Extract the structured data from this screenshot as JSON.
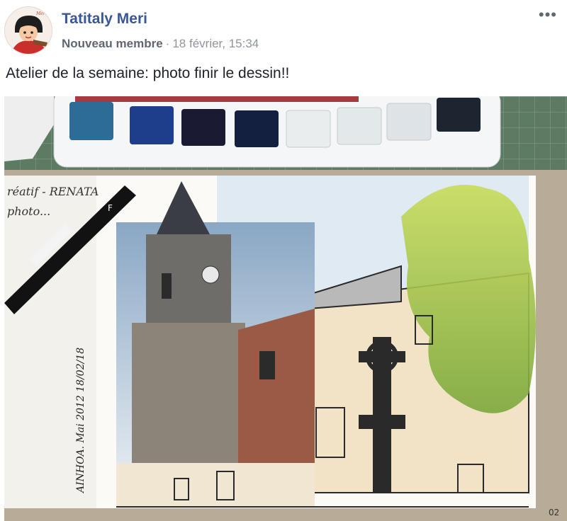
{
  "post": {
    "author": "Tatitaly Meri",
    "badge": "Nouveau membre",
    "separator": "·",
    "timestamp": "18 février, 15:34",
    "more_icon": "•••",
    "text": "Atelier de la semaine: photo finir le dessin!!"
  },
  "photo": {
    "pen_brand": "F",
    "note_line1": "réatif - RENATA",
    "note_line2": "photo...",
    "sketch_caption": "AINHOA. Mai 2012 18/02/18",
    "ruler_numbers": "02"
  }
}
